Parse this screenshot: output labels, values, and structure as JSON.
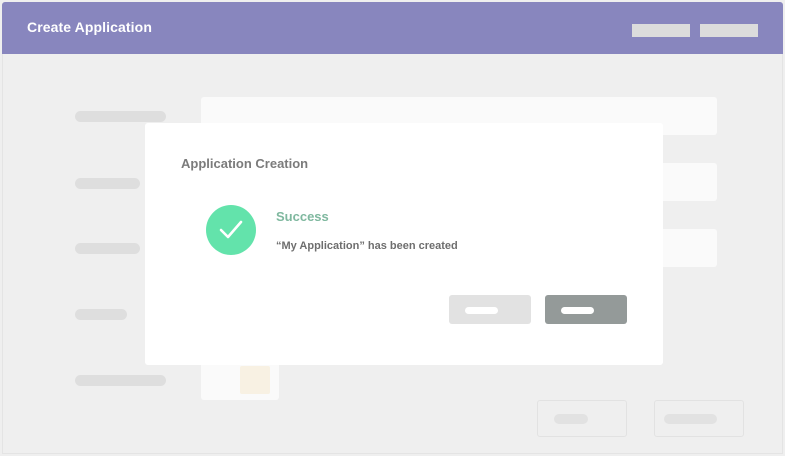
{
  "header": {
    "title": "Create Application"
  },
  "dialog": {
    "title": "Application Creation",
    "status": "Success",
    "message": "“My Application” has been created"
  },
  "icons": {
    "success": "check-icon"
  },
  "colors": {
    "header_bg": "#8886be",
    "success_circle": "#63e3ab",
    "success_text": "#7fb89f",
    "primary_button": "#949a99",
    "secondary_button": "#e2e2e2"
  }
}
